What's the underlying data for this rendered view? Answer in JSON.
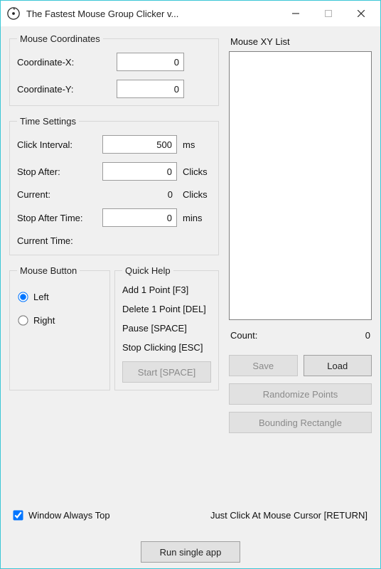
{
  "window": {
    "title": "The Fastest Mouse Group Clicker v..."
  },
  "coords": {
    "legend": "Mouse Coordinates",
    "x_label": "Coordinate-X:",
    "x_value": "0",
    "y_label": "Coordinate-Y:",
    "y_value": "0"
  },
  "time": {
    "legend": "Time Settings",
    "interval_label": "Click Interval:",
    "interval_value": "500",
    "interval_unit": "ms",
    "stop_after_label": "Stop After:",
    "stop_after_value": "0",
    "stop_after_unit": "Clicks",
    "current_label": "Current:",
    "current_value": "0",
    "current_unit": "Clicks",
    "stop_time_label": "Stop After Time:",
    "stop_time_value": "0",
    "stop_time_unit": "mins",
    "current_time_label": "Current Time:"
  },
  "mouse_btn": {
    "legend": "Mouse Button",
    "left_label": "Left",
    "right_label": "Right"
  },
  "help": {
    "legend": "Quick Help",
    "l1": "Add 1 Point [F3]",
    "l2": "Delete 1 Point [DEL]",
    "l3": "Pause [SPACE]",
    "l4": "Stop Clicking [ESC]",
    "start_btn": "Start [SPACE]"
  },
  "xy": {
    "legend": "Mouse XY List",
    "count_label": "Count:",
    "count_value": "0",
    "save": "Save",
    "load": "Load",
    "randomize": "Randomize Points",
    "bounding": "Bounding Rectangle"
  },
  "bottom": {
    "always_top": "Window Always Top",
    "cursor_hint": "Just Click At Mouse Cursor [RETURN]",
    "run_single": "Run single app"
  }
}
